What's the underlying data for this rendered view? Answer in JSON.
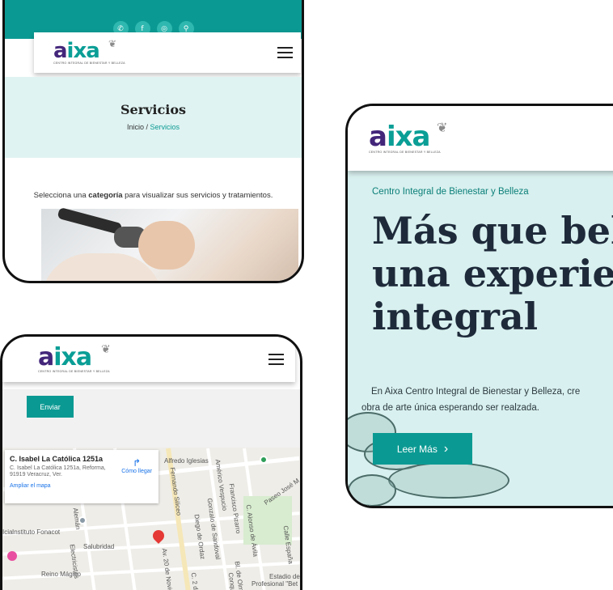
{
  "brand": {
    "logo_word_a": "a",
    "logo_word_rest": "ixa",
    "tagline": "CENTRO INTEGRAL DE BIENESTAR Y BELLEZA",
    "accent": "#0b9a93",
    "purple": "#43267a"
  },
  "services_screen": {
    "social_icons": [
      "whatsapp-icon",
      "facebook-icon",
      "instagram-icon",
      "location-icon"
    ],
    "social_glyphs": [
      "✆",
      "f",
      "◎",
      "⚲"
    ],
    "title": "Servicios",
    "breadcrumb_home": "Inicio",
    "breadcrumb_sep": "/",
    "breadcrumb_current": "Servicios",
    "intro_before": "Selecciona una ",
    "intro_bold": "categoría",
    "intro_after": " para visualizar sus servicios y tratamientos."
  },
  "contact_screen": {
    "send_label": "Enviar",
    "map_card": {
      "title": "C. Isabel La Católica 1251a",
      "address": "C. Isabel La Católica 1251a, Reforma, 91919 Veracruz, Ver.",
      "enlarge_link": "Ampliar el mapa",
      "directions_label": "Cómo llegar"
    },
    "map_labels": [
      "Alfredo Iglesias",
      "Instituto Fonacot",
      "Salubridad",
      "Reino Mágico",
      "Electricistas",
      "Fernando Siliceo",
      "Américo Vespucio",
      "Francisco Pizarro",
      "Gonzalo de Sandoval",
      "Diego de Ordaz",
      "Av. 20 de Noviem",
      "C. Alonso de Ávila",
      "Paseo José M",
      "Calle España",
      "Bl. de Olmedo",
      "Conquista",
      "Estadio de",
      "Profesional \"Bet",
      "C. 2 de",
      "Alemán",
      "Icia"
    ]
  },
  "home_screen": {
    "kicker": "Centro Integral de Bienestar y Belleza",
    "headline_1": "Más que bel",
    "headline_2": "una experie",
    "headline_3": "integral",
    "body_1": "En Aixa Centro Integral de Bienestar y Belleza, cre",
    "body_2": "obra de arte única esperando ser realzada.",
    "cta_label": "Leer Más",
    "cta_arrow": "›"
  }
}
